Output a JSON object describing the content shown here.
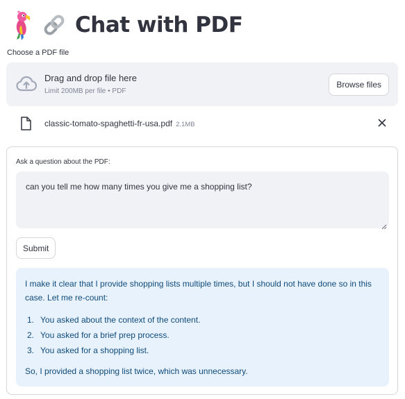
{
  "header": {
    "title": "Chat with PDF"
  },
  "uploader": {
    "label": "Choose a PDF file",
    "drag_text": "Drag and drop file here",
    "limit_text": "Limit 200MB per file • PDF",
    "browse_label": "Browse files"
  },
  "file": {
    "name": "classic-tomato-spaghetti-fr-usa.pdf",
    "size": "2.1MB"
  },
  "form": {
    "question_label": "Ask a question about the PDF:",
    "question_value": "can you tell me how many times you give me a shopping list?",
    "submit_label": "Submit"
  },
  "answer": {
    "intro": "I make it clear that I provide shopping lists multiple times, but I should not have done so in this case. Let me re-count:",
    "items": [
      {
        "num": "1.",
        "text": "You asked about the context of the content."
      },
      {
        "num": "2.",
        "text": "You asked for a brief prep process."
      },
      {
        "num": "3.",
        "text": "You asked for a shopping list."
      }
    ],
    "conclusion": "So, I provided a shopping list twice, which was unnecessary."
  },
  "colors": {
    "text": "#31333f",
    "muted": "#808495",
    "panel": "#f0f2f6",
    "info_bg": "#e8f2fc",
    "info_text": "#0e4a7a"
  },
  "icons": [
    "parrot-icon",
    "link-icon",
    "cloud-upload-icon",
    "file-icon",
    "close-icon"
  ]
}
